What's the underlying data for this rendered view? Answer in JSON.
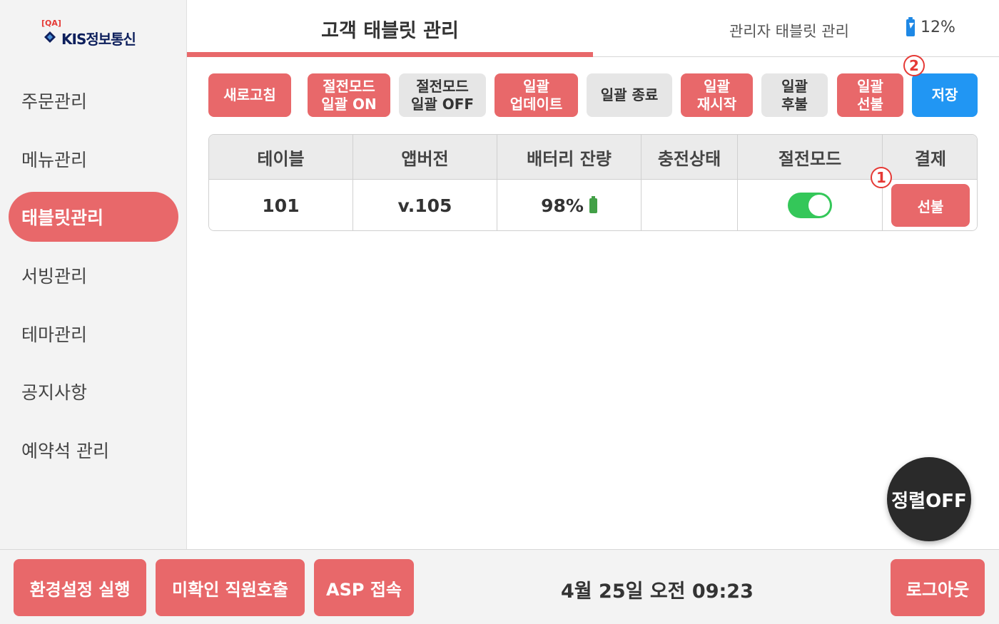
{
  "logo": {
    "tag": "[QA]",
    "text": "KIS정보통신"
  },
  "sidebar": {
    "items": [
      {
        "label": "주문관리"
      },
      {
        "label": "메뉴관리"
      },
      {
        "label": "태블릿관리"
      },
      {
        "label": "서빙관리"
      },
      {
        "label": "테마관리"
      },
      {
        "label": "공지사항"
      },
      {
        "label": "예약석 관리"
      }
    ],
    "active_index": 2
  },
  "header": {
    "tab_customer": "고객 태블릿 관리",
    "tab_admin": "관리자 태블릿 관리",
    "battery": "12%"
  },
  "toolbar": {
    "refresh": "새로고침",
    "power_on": "절전모드\n일괄 ON",
    "power_off": "절전모드\n일괄 OFF",
    "bulk_update": "일괄\n업데이트",
    "bulk_exit": "일괄 종료",
    "bulk_restart": "일괄\n재시작",
    "bulk_postpay": "일괄\n후불",
    "bulk_prepay": "일괄\n선불",
    "save": "저장"
  },
  "markers": {
    "one": "1",
    "two": "2"
  },
  "table": {
    "headers": [
      "테이블",
      "앱버전",
      "배터리 잔량",
      "충전상태",
      "절전모드",
      "결제"
    ],
    "rows": [
      {
        "table": "101",
        "version": "v.105",
        "battery": "98%",
        "charging": "",
        "power_save": true,
        "payment": "선불"
      }
    ]
  },
  "sort_button": "정렬OFF",
  "footer": {
    "settings": "환경설정 실행",
    "staff_call": "미확인 직원호출",
    "asp": "ASP 접속",
    "datetime": "4월 25일 오전 09:23",
    "logout": "로그아웃"
  },
  "colors": {
    "accent": "#e8686a",
    "save_blue": "#2196f3",
    "toggle_green": "#34c759"
  }
}
